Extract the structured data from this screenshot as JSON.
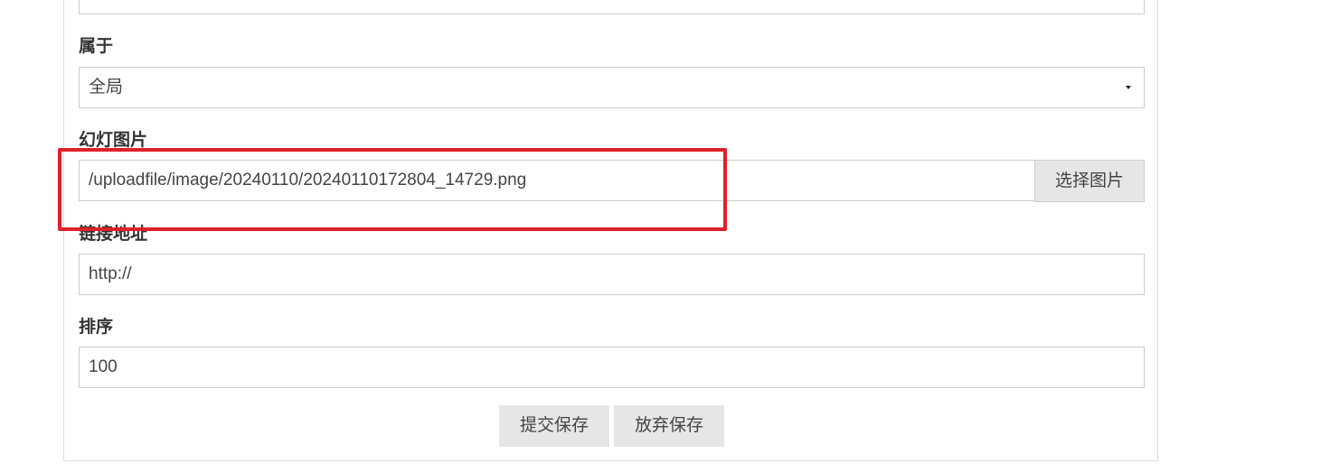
{
  "form": {
    "belongs_to": {
      "label": "属于",
      "selected": "全局"
    },
    "slide_image": {
      "label": "幻灯图片",
      "value": "/uploadfile/image/20240110/20240110172804_14729.png",
      "choose_button": "选择图片"
    },
    "link_url": {
      "label": "链接地址",
      "value": "http://"
    },
    "sort_order": {
      "label": "排序",
      "value": "100"
    },
    "actions": {
      "submit_label": "提交保存",
      "discard_label": "放弃保存"
    }
  },
  "colors": {
    "highlight": "#e0202a",
    "button_bg": "#e6e6e6",
    "border": "#cccccc"
  },
  "icons": {
    "select_caret": "caret-down-icon"
  }
}
